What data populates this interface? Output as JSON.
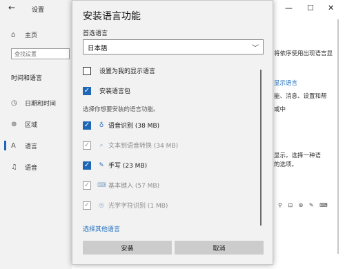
{
  "settings": {
    "back_glyph": "←",
    "app_title": "设置",
    "home_label": "主页",
    "search_placeholder": "查找设置",
    "section_label": "时间和语言",
    "nav_items": [
      {
        "label": "日期和时间",
        "icon": "clock-icon"
      },
      {
        "label": "区域",
        "icon": "globe-icon"
      },
      {
        "label": "语言",
        "icon": "language-icon"
      },
      {
        "label": "语音",
        "icon": "microphone-icon"
      }
    ],
    "window_controls": {
      "minimize": "—",
      "maximize": "☐",
      "close": "✕"
    },
    "right_fragments": {
      "line1": "将依序使用出现语言显",
      "link": "显示语言",
      "line2": "能、消息、设置和帮",
      "line3": "或中",
      "line4": "显示。选择一种语",
      "line5": "的选项。"
    }
  },
  "dialog": {
    "title": "安装语言功能",
    "preferred_label": "首选语言",
    "preferred_value": "日本語",
    "options": [
      {
        "label": "设置为我的显示语言",
        "checked": false,
        "disabled": false
      },
      {
        "label": "安装语言包",
        "checked": true,
        "disabled": false
      }
    ],
    "features_hint": "选择你想要安装的语言功能。",
    "features": [
      {
        "label": "语音识别 (38 MB)",
        "icon": "microphone-icon",
        "checked": true,
        "disabled": false
      },
      {
        "label": "文本到语音转换 (34 MB)",
        "icon": "speech-bubble-icon",
        "checked": true,
        "disabled": true
      },
      {
        "label": "手写 (23 MB)",
        "icon": "pen-icon",
        "checked": true,
        "disabled": false
      },
      {
        "label": "基本键入 (57 MB)",
        "icon": "keyboard-icon",
        "checked": true,
        "disabled": true
      },
      {
        "label": "光学字符识别 (1 MB)",
        "icon": "ocr-icon",
        "checked": true,
        "disabled": true
      }
    ],
    "other_language_link": "选择其他语言",
    "install_button": "安装",
    "cancel_button": "取消"
  },
  "colors": {
    "accent": "#1e66b6",
    "link": "#1e6fbf",
    "dialog_bg": "#f2f2f2",
    "button_bg": "#cccccc"
  }
}
